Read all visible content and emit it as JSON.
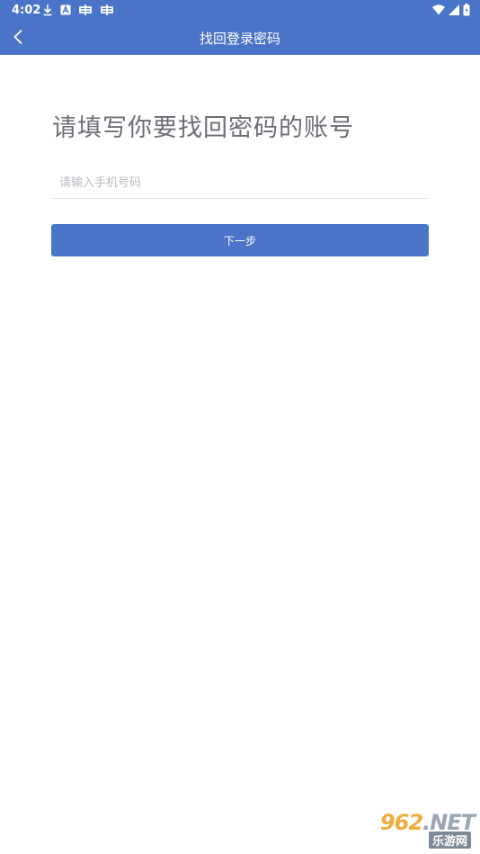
{
  "status_bar": {
    "time": "4:02",
    "left_icons": [
      "download-icon",
      "a-icon",
      "bug-icon",
      "bug-icon"
    ],
    "right_icons": [
      "wifi-icon",
      "signal-icon",
      "battery-icon"
    ]
  },
  "app_bar": {
    "title": "找回登录密码",
    "back_icon": "chevron-left-icon",
    "background": "#4a74c7"
  },
  "form": {
    "heading": "请填写你要找回密码的账号",
    "phone_input": {
      "placeholder": "请输入手机号码",
      "value": ""
    },
    "next_button_label": "下一步",
    "accent_color": "#4a74c7"
  },
  "watermark": {
    "main_text": "962",
    "suffix_text": ".NET",
    "sub_text": "乐游网"
  }
}
